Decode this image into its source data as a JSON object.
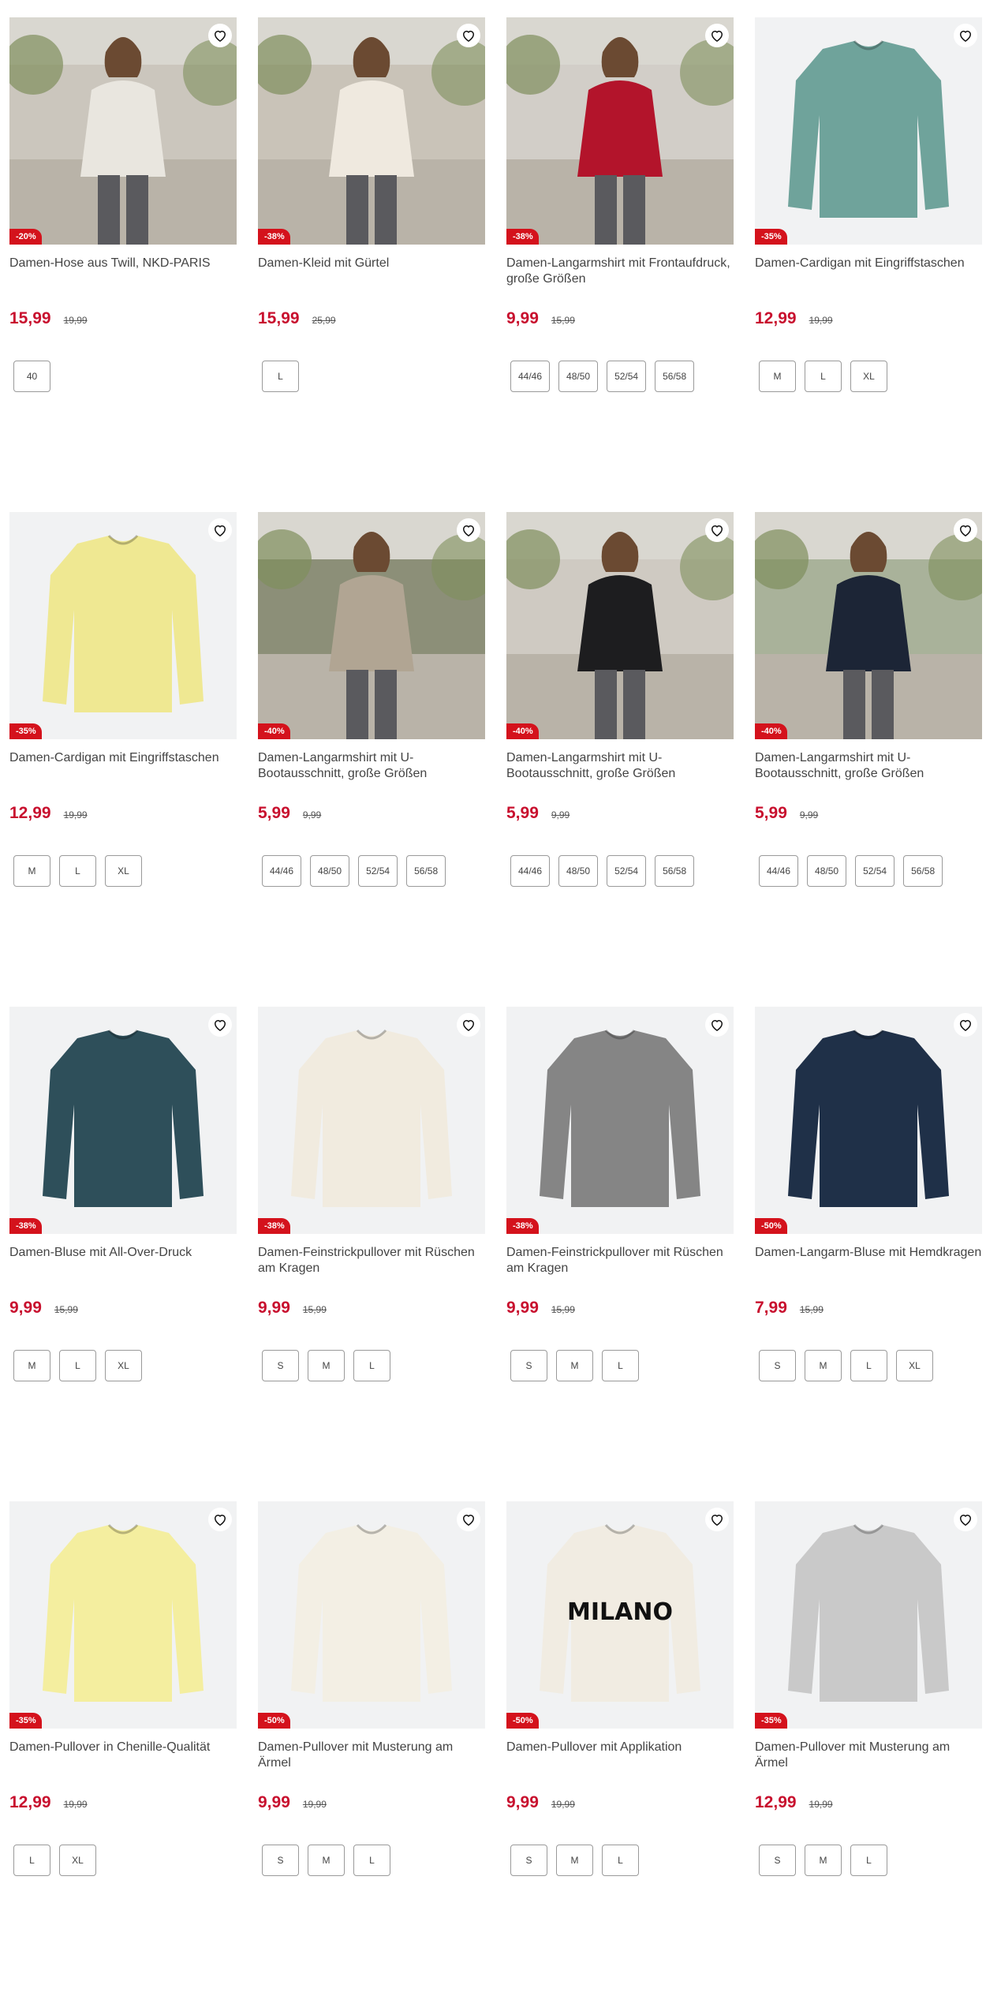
{
  "colors": {
    "price": "#c8102e",
    "badge": "#d4121c"
  },
  "products": [
    {
      "title": "Damen-Hose aus Twill, NKD-PARIS",
      "price": "15,99",
      "old_price": "19,99",
      "discount": "-20%",
      "sizes": [
        "40"
      ],
      "image": "woman-outdoor-white-jacket-grey-jeans",
      "photo_bg": "#cbc6bd",
      "garment": "#e9e6df"
    },
    {
      "title": "Damen-Kleid mit Gürtel",
      "price": "15,99",
      "old_price": "25,99",
      "discount": "-38%",
      "sizes": [
        "L"
      ],
      "image": "woman-outdoor-cream-dress",
      "photo_bg": "#c9c3b8",
      "garment": "#efe9df"
    },
    {
      "title": "Damen-Langarmshirt mit Frontaufdruck, große Größen",
      "price": "9,99",
      "old_price": "15,99",
      "discount": "-38%",
      "sizes": [
        "44/46",
        "48/50",
        "52/54",
        "56/58"
      ],
      "image": "woman-red-longsleeve",
      "photo_bg": "#d2cec8",
      "garment": "#b3142b"
    },
    {
      "title": "Damen-Cardigan mit Eingriffstaschen",
      "price": "12,99",
      "old_price": "19,99",
      "discount": "-35%",
      "sizes": [
        "M",
        "L",
        "XL"
      ],
      "image": "teal-cardigan",
      "photo_bg": "#f1f2f3",
      "garment": "#6fa39b"
    },
    {
      "title": "Damen-Cardigan mit Eingriffstaschen",
      "price": "12,99",
      "old_price": "19,99",
      "discount": "-35%",
      "sizes": [
        "M",
        "L",
        "XL"
      ],
      "image": "yellow-cardigan",
      "photo_bg": "#f1f2f3",
      "garment": "#efe892"
    },
    {
      "title": "Damen-Langarmshirt mit U-Bootausschnitt, große Größen",
      "price": "5,99",
      "old_price": "9,99",
      "discount": "-40%",
      "sizes": [
        "44/46",
        "48/50",
        "52/54",
        "56/58"
      ],
      "image": "woman-beige-longsleeve",
      "photo_bg": "#8c8f78",
      "garment": "#b1a593"
    },
    {
      "title": "Damen-Langarmshirt mit U-Bootausschnitt, große Größen",
      "price": "5,99",
      "old_price": "9,99",
      "discount": "-40%",
      "sizes": [
        "44/46",
        "48/50",
        "52/54",
        "56/58"
      ],
      "image": "woman-black-longsleeve",
      "photo_bg": "#cfcac2",
      "garment": "#1d1d1f"
    },
    {
      "title": "Damen-Langarmshirt mit U-Bootausschnitt, große Größen",
      "price": "5,99",
      "old_price": "9,99",
      "discount": "-40%",
      "sizes": [
        "44/46",
        "48/50",
        "52/54",
        "56/58"
      ],
      "image": "woman-navy-longsleeve",
      "photo_bg": "#a9b29a",
      "garment": "#1c2536"
    },
    {
      "title": "Damen-Bluse mit All-Over-Druck",
      "price": "9,99",
      "old_price": "15,99",
      "discount": "-38%",
      "sizes": [
        "M",
        "L",
        "XL"
      ],
      "image": "patterned-blouse",
      "photo_bg": "#f1f2f3",
      "garment": "#2e4f5a"
    },
    {
      "title": "Damen-Feinstrickpullover mit Rüschen am Kragen",
      "price": "9,99",
      "old_price": "15,99",
      "discount": "-38%",
      "sizes": [
        "S",
        "M",
        "L"
      ],
      "image": "cream-knit-sweater",
      "photo_bg": "#f1f2f3",
      "garment": "#f1ebdf"
    },
    {
      "title": "Damen-Feinstrickpullover mit Rüschen am Kragen",
      "price": "9,99",
      "old_price": "15,99",
      "discount": "-38%",
      "sizes": [
        "S",
        "M",
        "L"
      ],
      "image": "grey-knit-sweater",
      "photo_bg": "#f1f2f3",
      "garment": "#858585"
    },
    {
      "title": "Damen-Langarm-Bluse mit Hemdkragen",
      "price": "7,99",
      "old_price": "15,99",
      "discount": "-50%",
      "sizes": [
        "S",
        "M",
        "L",
        "XL"
      ],
      "image": "navy-striped-blouse",
      "photo_bg": "#f1f2f3",
      "garment": "#1f3048"
    },
    {
      "title": "Damen-Pullover in Chenille-Qualität",
      "price": "12,99",
      "old_price": "19,99",
      "discount": "-35%",
      "sizes": [
        "L",
        "XL"
      ],
      "image": "yellow-chenille-hoodie",
      "photo_bg": "#f1f2f3",
      "garment": "#f4ee9f"
    },
    {
      "title": "Damen-Pullover mit Musterung am Ärmel",
      "price": "9,99",
      "old_price": "19,99",
      "discount": "-50%",
      "sizes": [
        "S",
        "M",
        "L"
      ],
      "image": "cream-cable-sweater",
      "photo_bg": "#f1f2f3",
      "garment": "#f3efe4"
    },
    {
      "title": "Damen-Pullover mit Applikation",
      "price": "9,99",
      "old_price": "19,99",
      "discount": "-50%",
      "sizes": [
        "S",
        "M",
        "L"
      ],
      "image": "milano-sweater",
      "photo_bg": "#f1f2f3",
      "garment": "#f1ece2",
      "print": "MILANO"
    },
    {
      "title": "Damen-Pullover mit Musterung am Ärmel",
      "price": "12,99",
      "old_price": "19,99",
      "discount": "-35%",
      "sizes": [
        "S",
        "M",
        "L"
      ],
      "image": "grey-melange-sweater",
      "photo_bg": "#f1f2f3",
      "garment": "#c9c9c9"
    }
  ]
}
